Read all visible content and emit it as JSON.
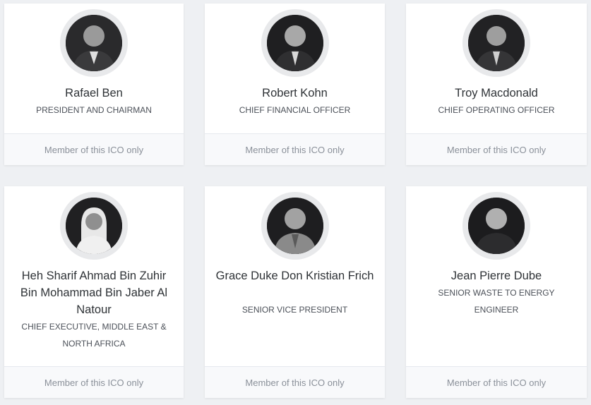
{
  "team": [
    {
      "name": "Rafael Ben",
      "role": "PRESIDENT AND CHAIRMAN",
      "footer": "Member of this ICO only",
      "avatar_icon": "person-photo-icon"
    },
    {
      "name": "Robert Kohn",
      "role": "CHIEF FINANCIAL OFFICER",
      "footer": "Member of this ICO only",
      "avatar_icon": "person-photo-icon"
    },
    {
      "name": "Troy Macdonald",
      "role": "CHIEF OPERATING OFFICER",
      "footer": "Member of this ICO only",
      "avatar_icon": "person-photo-icon"
    },
    {
      "name": "Heh Sharif Ahmad Bin Zuhir Bin Mohammad Bin Jaber Al Natour",
      "role": "CHIEF EXECUTIVE, MIDDLE EAST & NORTH AFRICA",
      "footer": "Member of this ICO only",
      "avatar_icon": "person-photo-icon"
    },
    {
      "name": "Grace Duke Don Kristian Frich",
      "role": "SENIOR VICE PRESIDENT",
      "footer": "Member of this ICO only",
      "avatar_icon": "person-photo-icon"
    },
    {
      "name": "Jean Pierre Dube",
      "role": "SENIOR WASTE TO ENERGY ENGINEER",
      "footer": "Member of this ICO only",
      "avatar_icon": "person-photo-icon"
    }
  ]
}
